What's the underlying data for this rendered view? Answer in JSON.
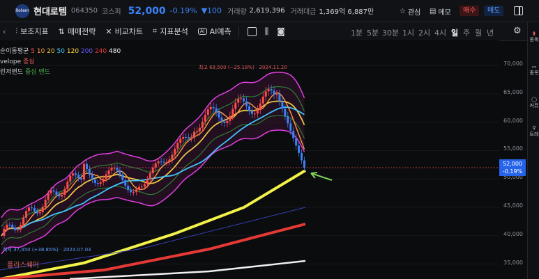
{
  "header": {
    "logo_text": "Rotem",
    "stock_name": "현대로템",
    "stock_code": "064350",
    "market": "코스피",
    "price": "52,000",
    "change_pct": "-0.19%",
    "change_val": "▼100",
    "volume_label": "거래량",
    "volume": "2,619,396",
    "amount_label": "거래대금",
    "amount": "1,369억 6,887만",
    "watch_label": "관심",
    "memo_label": "메모",
    "buy_label": "매수",
    "sell_label": "매도"
  },
  "toolbar": {
    "items": [
      "보조지표",
      "매매전략",
      "비교차트",
      "지표분석",
      "AI예측"
    ],
    "periods": [
      "1분",
      "5분",
      "30분",
      "1시",
      "2시",
      "4시",
      "일",
      "주",
      "월",
      "년"
    ],
    "active_period": "일"
  },
  "legend": {
    "ma_label": "순이동평균",
    "ma_periods": [
      "5",
      "10",
      "20",
      "50",
      "120",
      "200",
      "240",
      "480"
    ],
    "ma_colors": [
      "#ff4b4b",
      "#ff9f40",
      "#e8c547",
      "#40c4ff",
      "#ffd84a",
      "#6a5cff",
      "#e53935",
      "#f0f0f0"
    ],
    "envelope_label": "velope",
    "envelope_value": "중심",
    "bollinger_label": "린저밴드",
    "bollinger_value": "중심 밴드"
  },
  "annotations": {
    "high": "최고 69,500 (−25.18%) · 2024.11.20",
    "low": "최저 37,450 (+38.85%) · 2024.07.03",
    "watermark": "플라스퀘어"
  },
  "price_axis": {
    "ticks": [
      "70,000",
      "65,000",
      "60,000",
      "55,000",
      "50,000",
      "45,000",
      "40,000",
      "35,000"
    ],
    "current_price": "52,000",
    "current_change": "-0.19%"
  },
  "sidebar": {
    "items": [
      "종목",
      "종목",
      "커뮤",
      "트레"
    ]
  },
  "colors": {
    "up": "#ff4b4b",
    "down": "#3b82f6",
    "accent": "#2563eb"
  }
}
